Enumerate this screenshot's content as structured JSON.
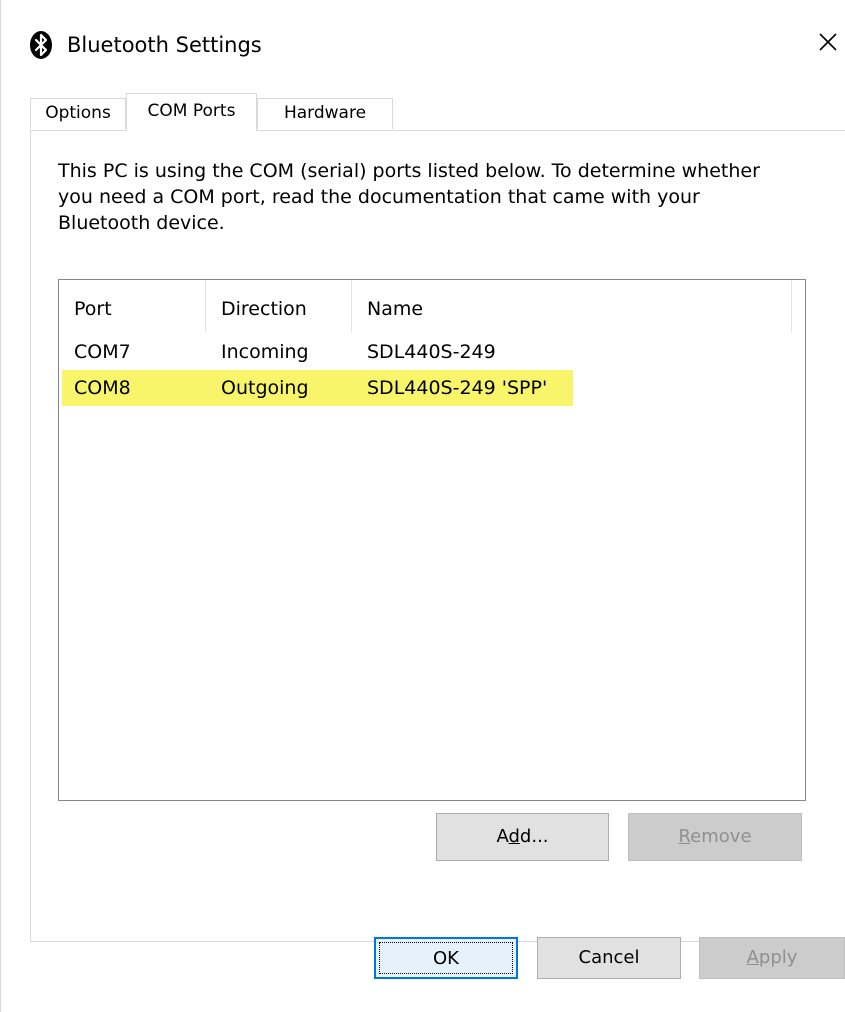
{
  "window": {
    "title": "Bluetooth Settings",
    "icon": "bluetooth-icon",
    "close_icon": "close-icon"
  },
  "tabs": [
    {
      "label": "Options",
      "active": false
    },
    {
      "label": "COM Ports",
      "active": true
    },
    {
      "label": "Hardware",
      "active": false
    }
  ],
  "description": "This PC is using the COM (serial) ports listed below. To determine whether you need a COM port, read the documentation that came with your Bluetooth device.",
  "ports_table": {
    "columns": [
      "Port",
      "Direction",
      "Name"
    ],
    "rows": [
      {
        "port": "COM7",
        "direction": "Incoming",
        "name": "SDL440S-249"
      },
      {
        "port": "COM8",
        "direction": "Outgoing",
        "name": "SDL440S-249 'SPP'"
      }
    ],
    "highlight_color": "#f9f56b"
  },
  "buttons": {
    "add": {
      "pre": "A",
      "mnemonic": "d",
      "post": "d..."
    },
    "remove": {
      "pre": "",
      "mnemonic": "R",
      "post": "emove"
    },
    "ok": "OK",
    "cancel": "Cancel",
    "apply": {
      "pre": "",
      "mnemonic": "A",
      "post": "pply"
    }
  },
  "colors": {
    "focus_border": "#0078d7",
    "listview_border": "#828790"
  }
}
